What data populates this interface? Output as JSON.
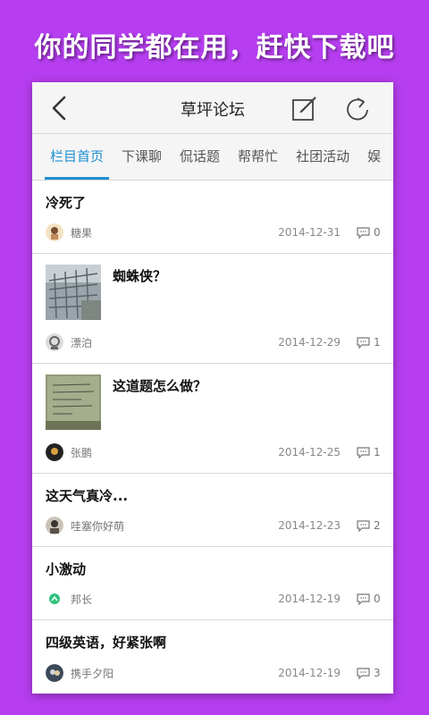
{
  "promo": {
    "text": "你的同学都在用，赶快下载吧"
  },
  "header": {
    "title": "草坪论坛"
  },
  "tabs": [
    {
      "label": "栏目首页",
      "active": true
    },
    {
      "label": "下课聊"
    },
    {
      "label": "侃话题"
    },
    {
      "label": "帮帮忙"
    },
    {
      "label": "社团活动"
    },
    {
      "label": "娱"
    }
  ],
  "posts": [
    {
      "title": "冷死了",
      "author": "糖果",
      "date": "2014-12-31",
      "comments": "0",
      "has_image": false
    },
    {
      "title": "蜘蛛侠？",
      "author": "漂泊",
      "date": "2014-12-29",
      "comments": "1",
      "has_image": true
    },
    {
      "title": "这道题怎么做？",
      "author": "张鹏",
      "date": "2014-12-25",
      "comments": "1",
      "has_image": true
    },
    {
      "title": "这天气真冷...",
      "author": "哇塞你好萌",
      "date": "2014-12-23",
      "comments": "2",
      "has_image": false
    },
    {
      "title": "小激动",
      "author": "邦长",
      "date": "2014-12-19",
      "comments": "0",
      "has_image": false
    },
    {
      "title": "四级英语，好紧张啊",
      "author": "携手夕阳",
      "date": "2014-12-19",
      "comments": "3",
      "has_image": false
    }
  ],
  "colors": {
    "background": "#b63ef0",
    "accent": "#1f8fd1"
  }
}
